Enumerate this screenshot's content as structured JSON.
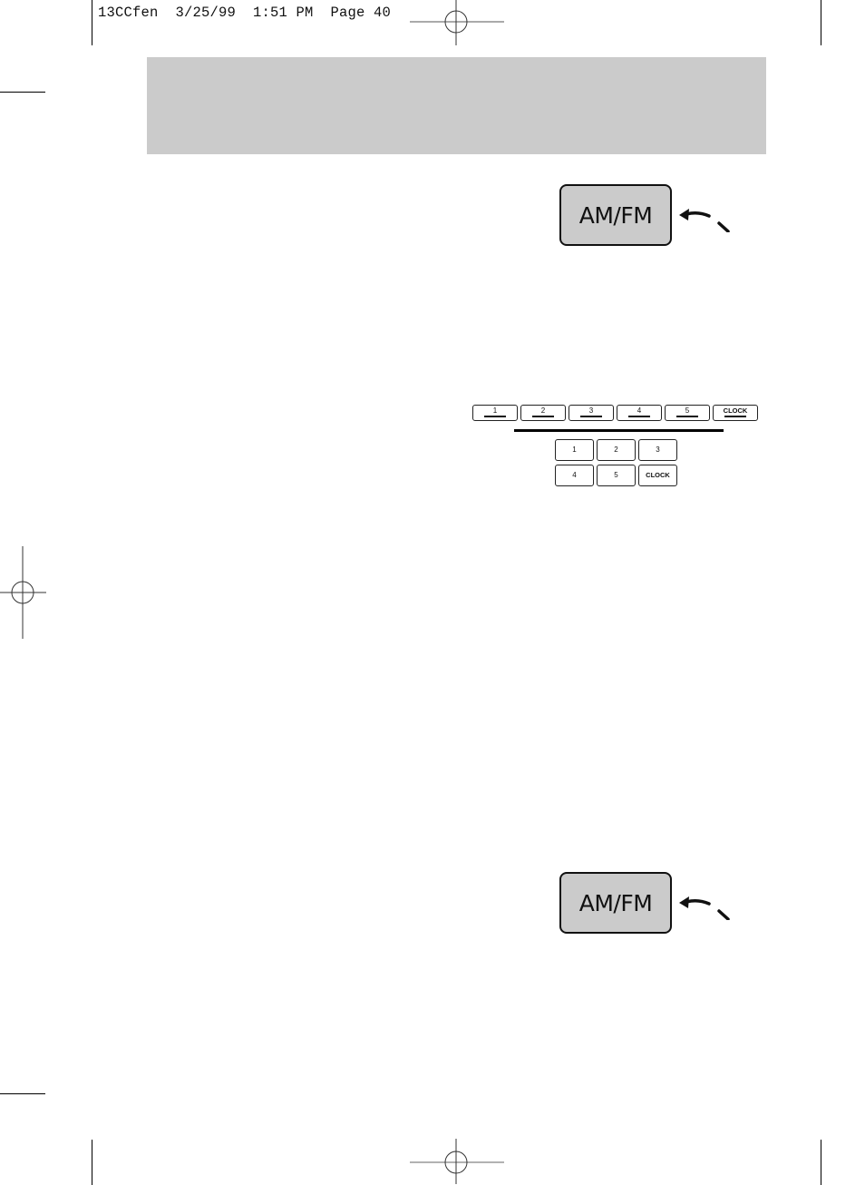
{
  "print_slug": {
    "file": "13CCfen",
    "date": "3/25/99",
    "time": "1:51 PM",
    "page": "Page 40",
    "text": "13CCfen  3/25/99  1:51 PM  Page 40"
  },
  "header_band": {
    "color": "#cbcbcb"
  },
  "illustrations": {
    "amfm_button_top": {
      "label": "AM/FM",
      "icon": "press-arrow-icon"
    },
    "preset_strip": {
      "buttons": [
        "1",
        "2",
        "3",
        "4",
        "5",
        "CLOCK"
      ]
    },
    "preset_grid": {
      "buttons": [
        "1",
        "2",
        "3",
        "4",
        "5",
        "CLOCK"
      ]
    },
    "amfm_button_bottom": {
      "label": "AM/FM",
      "icon": "press-arrow-icon"
    }
  },
  "colors": {
    "button_fill": "#cbcbcb",
    "ink": "#111111"
  }
}
